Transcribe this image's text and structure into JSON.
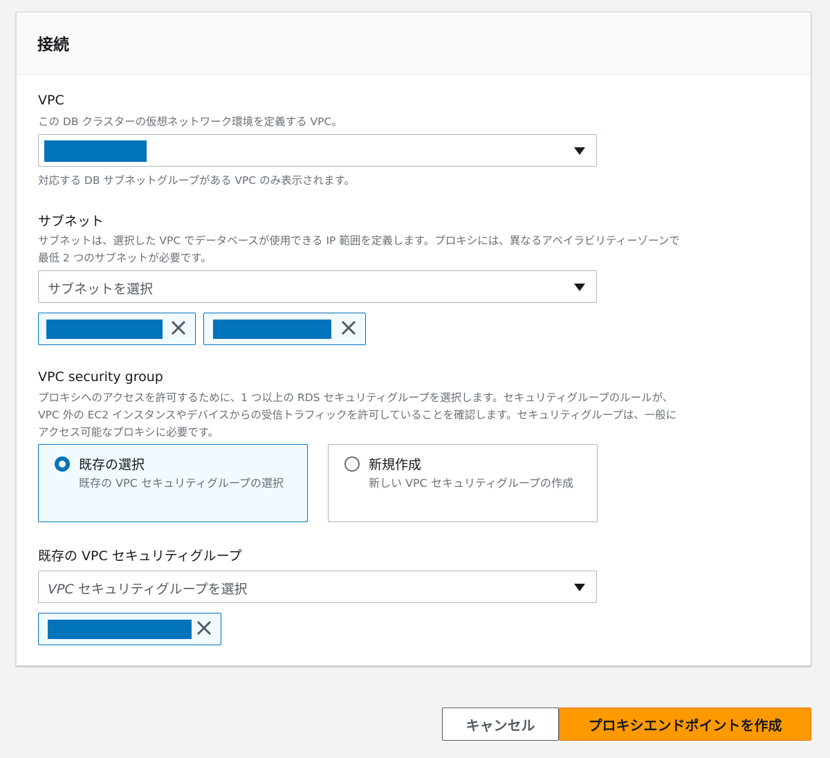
{
  "section": {
    "title": "接続"
  },
  "vpc": {
    "label": "VPC",
    "description": "この DB クラスターの仮想ネットワーク環境を定義する VPC。",
    "hint": "対応する DB サブネットグループがある VPC のみ表示されます。"
  },
  "subnet": {
    "label": "サブネット",
    "description_line1": "サブネットは、選択した VPC でデータベースが使用できる IP 範囲を定義します。プロキシには、異なるアベイラビリティーゾーンで",
    "description_line2": "最低 2 つのサブネットが必要です。",
    "placeholder": "サブネットを選択"
  },
  "security_group": {
    "label": "VPC security group",
    "description_line1": "プロキシへのアクセスを許可するために、1 つ以上の RDS セキュリティグループを選択します。セキュリティグループのルールが、",
    "description_line2": "VPC 外の EC2 インスタンスやデバイスからの受信トラフィックを許可していることを確認します。セキュリティグループは、一般に",
    "description_line3": "アクセス可能なプロキシに必要です。",
    "options": [
      {
        "title": "既存の選択",
        "description": "既存の VPC セキュリティグループの選択",
        "selected": true
      },
      {
        "title": "新規作成",
        "description": "新しい VPC セキュリティグループの作成",
        "selected": false
      }
    ]
  },
  "existing_sg": {
    "label": "既存の VPC セキュリティグループ",
    "placeholder_italic": "VPC",
    "placeholder_rest": " セキュリティグループを選択"
  },
  "footer": {
    "cancel_label": "キャンセル",
    "create_label": "プロキシエンドポイントを作成"
  },
  "colors": {
    "accent": "#0073bb",
    "primary_button": "#ff9900"
  }
}
